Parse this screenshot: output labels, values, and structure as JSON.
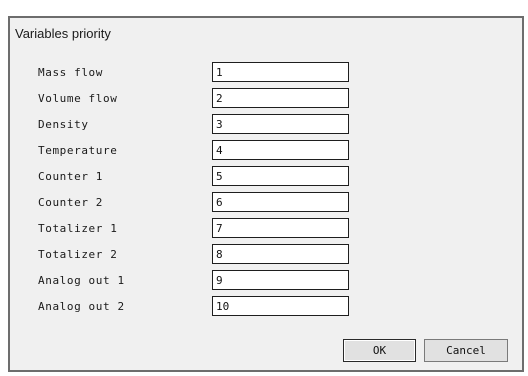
{
  "dialog": {
    "title": "Variables priority",
    "rows": [
      {
        "label": "Mass flow",
        "value": "1"
      },
      {
        "label": "Volume flow",
        "value": "2"
      },
      {
        "label": "Density",
        "value": "3"
      },
      {
        "label": "Temperature",
        "value": "4"
      },
      {
        "label": "Counter 1",
        "value": "5"
      },
      {
        "label": "Counter 2",
        "value": "6"
      },
      {
        "label": "Totalizer 1",
        "value": "7"
      },
      {
        "label": "Totalizer 2",
        "value": "8"
      },
      {
        "label": "Analog out 1",
        "value": "9"
      },
      {
        "label": "Analog out 2",
        "value": "10"
      }
    ],
    "ok_label": "OK",
    "cancel_label": "Cancel"
  }
}
